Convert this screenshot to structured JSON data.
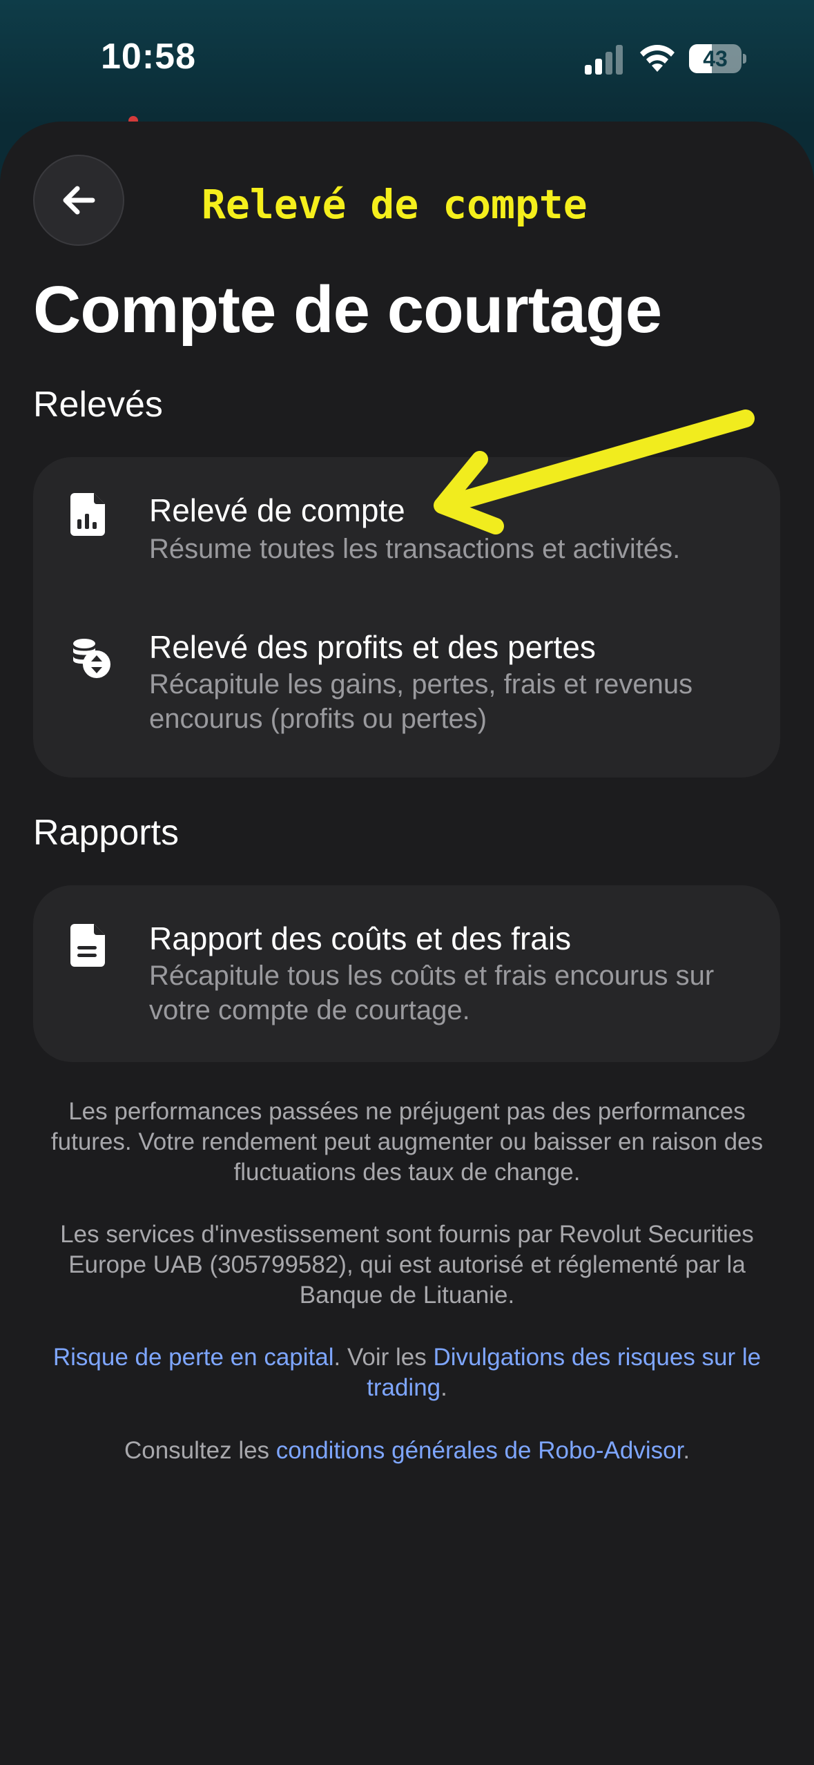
{
  "status_bar": {
    "time": "10:58",
    "battery": "43",
    "battery_level_percent": 43
  },
  "header": {
    "annotation_title": "Relevé de compte",
    "page_title": "Compte de courtage"
  },
  "statements": {
    "heading": "Relevés",
    "items": [
      {
        "title": "Relevé de compte",
        "description": "Résume toutes les transactions et activités.",
        "icon": "document-chart-icon"
      },
      {
        "title": "Relevé des profits et des pertes",
        "description": "Récapitule les gains, pertes, frais et revenus encourus (profits ou pertes)",
        "icon": "coins-arrows-icon"
      }
    ]
  },
  "reports": {
    "heading": "Rapports",
    "items": [
      {
        "title": "Rapport des coûts et des frais",
        "description": "Récapitule tous les coûts et frais encourus sur votre compte de courtage.",
        "icon": "document-lines-icon"
      }
    ]
  },
  "disclaimers": {
    "performance": "Les performances passées ne préjugent pas des performances futures. Votre rendement peut augmenter ou baisser en raison des fluctuations des taux de change.",
    "services": "Les services d'investissement sont fournis par Revolut Securities Europe UAB (305799582), qui est autorisé et réglementé par la Banque de Lituanie.",
    "risk_link": "Risque de perte en capital",
    "risk_middle": ". Voir les ",
    "risk_disclosure_link": "Divulgations des risques sur le trading",
    "risk_end": ".",
    "terms_prefix": "Consultez les ",
    "terms_link": "conditions générales de Robo-Advisor",
    "terms_end": "."
  },
  "colors": {
    "background": "#1c1c1e",
    "card": "#262628",
    "link": "#7ea6ff",
    "annotation": "#f5ef1c"
  }
}
